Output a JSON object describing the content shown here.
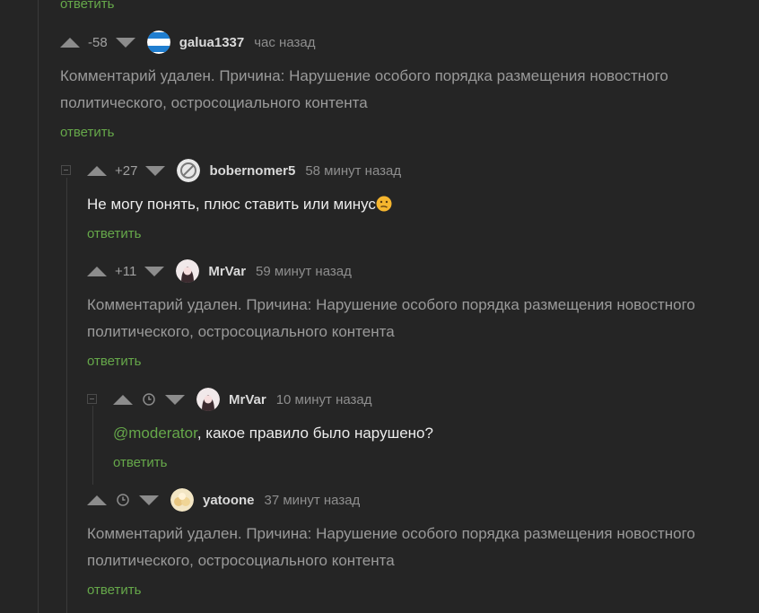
{
  "top_reply": "ответить",
  "comments": [
    {
      "rating": "-58",
      "username": "galua1337",
      "time": "час назад",
      "text_line1": "Комментарий удален. Причина: Нарушение особого порядка размещения новостного",
      "text_line2": "политического, остросоциального контента",
      "reply": "ответить",
      "avatar_colors": [
        "#1f7ed0",
        "#ffffff"
      ]
    },
    {
      "rating": "+27",
      "username": "bobernomer5",
      "time": "58 минут назад",
      "text": "Не могу понять, плюс ставить или минус",
      "emoji": "confused-face-emoji",
      "reply": "ответить"
    },
    {
      "rating": "+11",
      "username": "MrVar",
      "time": "59 минут назад",
      "text_line1": "Комментарий удален. Причина: Нарушение особого порядка размещения новостного",
      "text_line2": "политического, остросоциального контента",
      "reply": "ответить"
    },
    {
      "username": "MrVar",
      "time": "10 минут назад",
      "mention": "@moderator",
      "text": ", какое правило было нарушено?",
      "reply": "ответить"
    },
    {
      "username": "yatoone",
      "time": "37 минут назад",
      "text_line1": "Комментарий удален. Причина: Нарушение особого порядка размещения новостного",
      "text_line2": "политического, остросоциального контента",
      "reply": "ответить"
    }
  ],
  "colors": {
    "background": "#252525",
    "link_green": "#66a84a",
    "deleted_text": "#9a9a9a",
    "vote_arrow": "#8c8c8c"
  }
}
